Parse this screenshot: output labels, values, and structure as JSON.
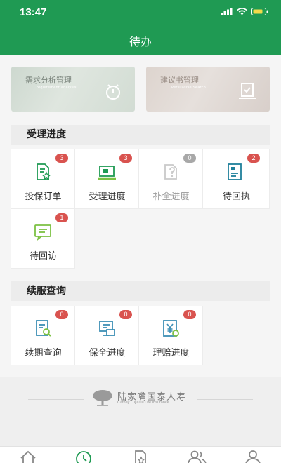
{
  "status_bar": {
    "time": "13:47"
  },
  "header": {
    "title": "待办"
  },
  "banners": [
    {
      "title": "需求分析管理",
      "subtitle": "requirement analysis",
      "icon": "stopwatch-icon"
    },
    {
      "title": "建议书管理",
      "subtitle": "Persuasive Search",
      "icon": "document-check-icon"
    }
  ],
  "section_acceptance": {
    "title": "受理进度",
    "items": [
      {
        "label": "投保订单",
        "badge": "3",
        "icon": "policy-order-icon"
      },
      {
        "label": "受理进度",
        "badge": "3",
        "icon": "acceptance-progress-icon"
      },
      {
        "label": "补全进度",
        "badge": "0",
        "icon": "supplement-progress-icon"
      },
      {
        "label": "待回执",
        "badge": "2",
        "icon": "pending-receipt-icon"
      },
      {
        "label": "待回访",
        "badge": "1",
        "icon": "pending-visit-icon"
      }
    ]
  },
  "section_renewal": {
    "title": "续服查询",
    "items": [
      {
        "label": "续期查询",
        "badge": "0",
        "icon": "renewal-query-icon"
      },
      {
        "label": "保全进度",
        "badge": "0",
        "icon": "preservation-progress-icon"
      },
      {
        "label": "理赔进度",
        "badge": "0",
        "icon": "claim-progress-icon"
      }
    ]
  },
  "footer": {
    "company": "陆家嘴国泰人寿",
    "company_en": "Cathay Lujiazui Life Insurance"
  },
  "tabbar": [
    "home-icon",
    "clock-icon",
    "document-star-icon",
    "contacts-icon",
    "profile-icon"
  ],
  "colors": {
    "brand": "#1f9a53",
    "badge": "#d9534f",
    "badge_inactive": "#a8a8a8"
  }
}
